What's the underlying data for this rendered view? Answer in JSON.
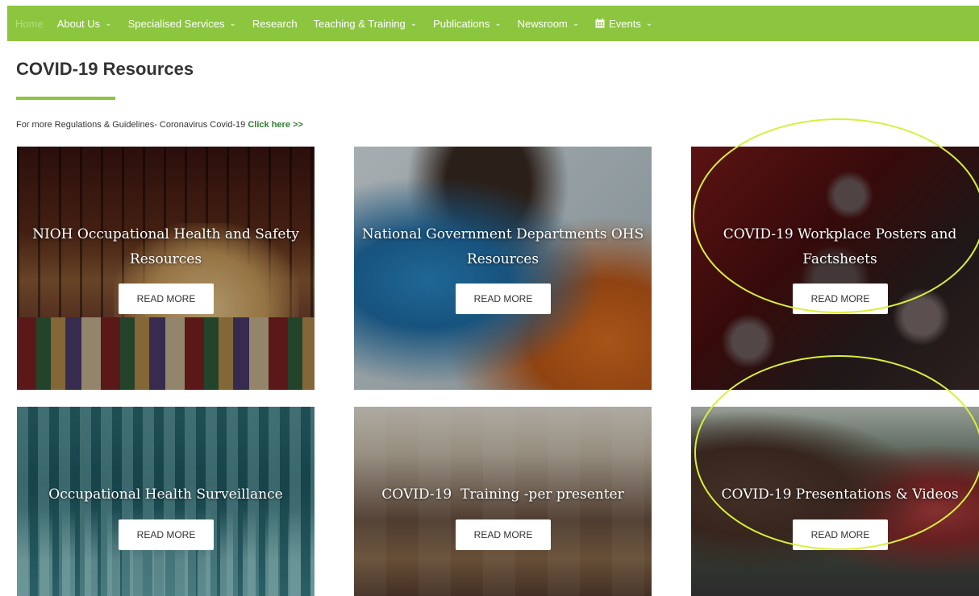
{
  "nav": {
    "home": "Home",
    "items": [
      {
        "label": "About Us",
        "dropdown": true
      },
      {
        "label": "Specialised Services",
        "dropdown": true
      },
      {
        "label": "Research",
        "dropdown": false
      },
      {
        "label": "Teaching & Training",
        "dropdown": true
      },
      {
        "label": "Publications",
        "dropdown": true
      },
      {
        "label": "Newsroom",
        "dropdown": true
      },
      {
        "label": "Events",
        "dropdown": true,
        "icon": "calendar-icon"
      }
    ],
    "chevron_glyph": "⌄"
  },
  "page": {
    "title": "COVID-19 Resources",
    "intro_text": "For more Regulations & Guidelines- Coronavirus Covid-19 ",
    "intro_link": "Click here >>"
  },
  "cards": [
    {
      "title": "NIOH Occupational Health and Safety Resources",
      "button": "READ MORE"
    },
    {
      "title": "National Government Departments OHS Resources",
      "button": "READ MORE"
    },
    {
      "title": "COVID-19 Workplace Posters and Factsheets",
      "button": "READ MORE"
    },
    {
      "title": "Occupational Health Surveillance",
      "button": "READ MORE"
    },
    {
      "title": "COVID-19  Training -per presenter",
      "button": "READ MORE"
    },
    {
      "title": "COVID-19 Presentations & Videos",
      "button": "READ MORE"
    }
  ],
  "colors": {
    "nav_bg": "#8cc63f",
    "accent": "#8cc63f",
    "link": "#2e7d32",
    "annotation": "#d8f03a"
  }
}
